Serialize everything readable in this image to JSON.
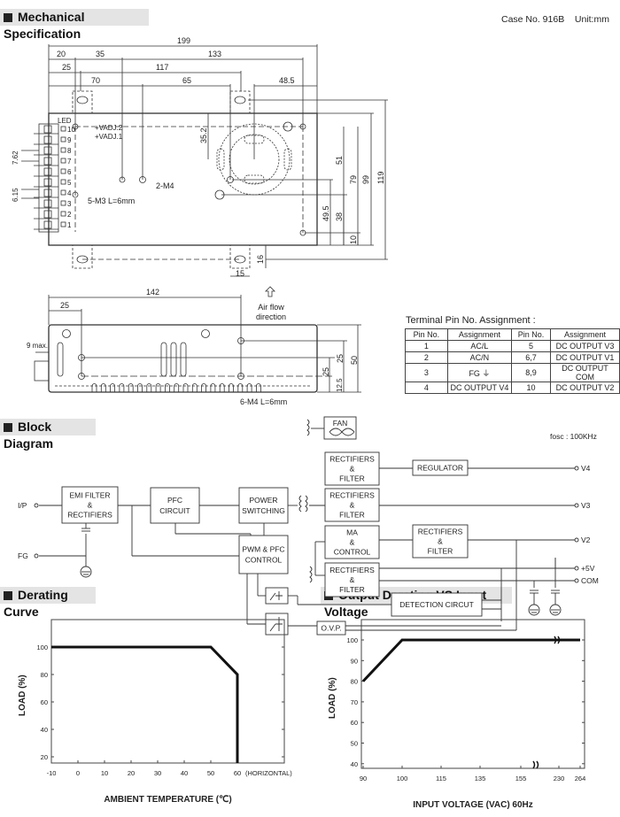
{
  "sections": {
    "mechanical": "Mechanical Specification",
    "block": "Block Diagram",
    "derating": "Derating Curve",
    "output_derating": "Output Derating VS Input Voltage"
  },
  "case_info": "Case No. 916B    Unit:mm",
  "mechanical": {
    "top_dims": {
      "d199": "199",
      "d20": "20",
      "d35": "35",
      "d133": "133",
      "d25": "25",
      "d117": "117",
      "d70": "70",
      "d65": "65",
      "d48_5": "48.5",
      "d35_2": "35.2",
      "d51": "51",
      "d79": "79",
      "d99": "99",
      "d119": "119",
      "d49_5": "49.5",
      "d38": "38",
      "d10": "10",
      "d16": "16",
      "d15": "15",
      "d7_62": "7.62",
      "d6_15": "6.15"
    },
    "labels": {
      "led": "LED",
      "vadj2": "+VADJ.2",
      "vadj1": "+VADJ.1",
      "m4": "2-M4",
      "m3": "5-M3 L=6mm"
    },
    "pins": [
      "1",
      "2",
      "3",
      "4",
      "5",
      "6",
      "7",
      "8",
      "9",
      "10"
    ],
    "side": {
      "d142": "142",
      "d25": "25",
      "airflow1": "Air flow",
      "airflow2": "direction",
      "max9": "9 max.",
      "m4": "6-M4 L=6mm",
      "r25a": "25",
      "r25b": "25",
      "r50": "50",
      "r12_5": "12.5"
    }
  },
  "terminal_table": {
    "title": "Terminal Pin No. Assignment :",
    "headers": [
      "Pin No.",
      "Assignment",
      "Pin No.",
      "Assignment"
    ],
    "rows": [
      [
        "1",
        "AC/L",
        "5",
        "DC OUTPUT V3"
      ],
      [
        "2",
        "AC/N",
        "6,7",
        "DC OUTPUT V1"
      ],
      [
        "3",
        "FG ⏚",
        "8,9",
        "DC OUTPUT COM"
      ],
      [
        "4",
        "DC OUTPUT V4",
        "10",
        "DC OUTPUT V2"
      ]
    ]
  },
  "block_diagram": {
    "fosc": "fosc : 100KHz",
    "ip": "I/P",
    "fg": "FG",
    "emi": [
      "EMI FILTER",
      "&",
      "RECTIFIERS"
    ],
    "pfc": [
      "PFC",
      "CIRCUIT"
    ],
    "power": [
      "POWER",
      "SWITCHING"
    ],
    "pwm": [
      "PWM & PFC",
      "CONTROL"
    ],
    "fan": "FAN",
    "rf": [
      "RECTIFIERS",
      "&",
      "FILTER"
    ],
    "ma": [
      "MA",
      "&",
      "CONTROL"
    ],
    "regulator": "REGULATOR",
    "detection": "DETECTION CIRCUT",
    "ovp": "O.V.P.",
    "outputs": {
      "v4": "V4",
      "v3": "V3",
      "v2": "V2",
      "p5v": "+5V",
      "com": "COM"
    }
  },
  "chart_data": [
    {
      "type": "line",
      "title": "Derating Curve",
      "xlabel": "AMBIENT TEMPERATURE (℃)",
      "ylabel": "LOAD (%)",
      "x_ticks": [
        "-10",
        "0",
        "10",
        "20",
        "30",
        "40",
        "50",
        "60"
      ],
      "x_tick_note": "(HORIZONTAL)",
      "y_ticks": [
        "20",
        "40",
        "60",
        "80",
        "100"
      ],
      "xlim": [
        -10,
        70
      ],
      "ylim": [
        15,
        120
      ],
      "grid": false,
      "series": [
        {
          "x": [
            -10,
            50,
            60,
            60
          ],
          "y": [
            100,
            100,
            80,
            15
          ]
        }
      ],
      "color": "#111111"
    },
    {
      "type": "line",
      "title": "Output Derating VS Input Voltage",
      "xlabel": "INPUT VOLTAGE (VAC) 60Hz",
      "ylabel": "LOAD (%)",
      "x_ticks": [
        "90",
        "100",
        "115",
        "135",
        "155",
        "230",
        "264"
      ],
      "x_axis_break": "between 155 and 230",
      "y_ticks": [
        "40",
        "50",
        "60",
        "70",
        "80",
        "90",
        "100"
      ],
      "ylim": [
        38,
        110
      ],
      "grid": false,
      "series": [
        {
          "x": [
            90,
            100,
            264
          ],
          "y": [
            80,
            100,
            100
          ]
        }
      ],
      "color": "#111111"
    }
  ]
}
